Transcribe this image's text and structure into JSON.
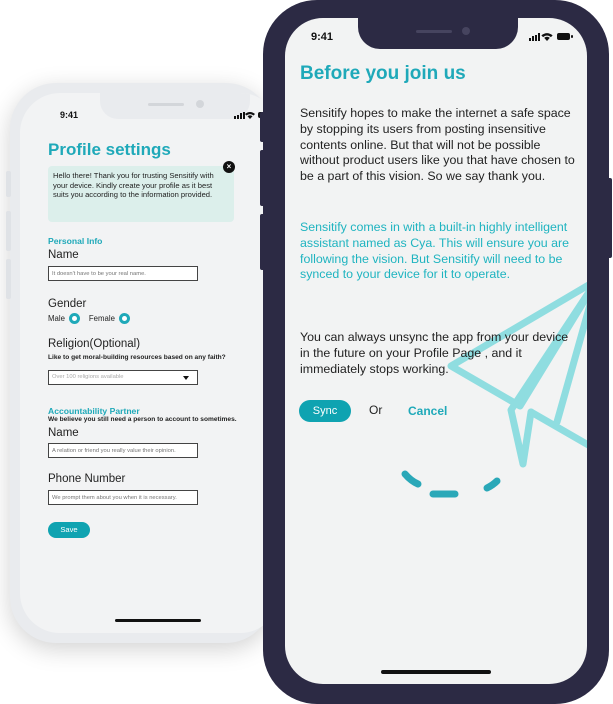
{
  "profile_phone": {
    "status_time": "9:41",
    "title": "Profile settings",
    "welcome_message": "Hello there! Thank you for trusting Sensitify with your device. Kindly create your profile as it best suits you according to the information provided.",
    "close_glyph": "×",
    "personal_info": {
      "section_title": "Personal Info",
      "name_label": "Name",
      "name_placeholder": "It doesn't have to be your real name."
    },
    "gender": {
      "label": "Gender",
      "male_label": "Male",
      "female_label": "Female"
    },
    "religion": {
      "label": "Religion(Optional)",
      "subtitle": "Like to get moral-building resources based on any faith?",
      "select_placeholder": "Over 100 religions available"
    },
    "accountability": {
      "section_title": "Accountability Partner",
      "subtitle": "We believe you still need a person to account to sometimes.",
      "name_label": "Name",
      "name_placeholder": "A relation or friend you really value their opinion.",
      "phone_label": "Phone Number",
      "phone_placeholder": "We prompt them about you when it is necessary."
    },
    "save_label": "Save"
  },
  "join_phone": {
    "status_time": "9:41",
    "title": "Before you join us",
    "paragraph_1": "Sensitify hopes to make the internet a safe space by stopping its users from posting insensitive contents online. But that will not be possible without product users like you that have chosen to be a part of this vision. So we say thank you.",
    "paragraph_2": "Sensitify  comes in with a built-in highly intelligent assistant named as Cya. This will ensure you are following the vision. But Sensitify will need to be synced to your device for it to operate.",
    "paragraph_3": "You can always unsync the app from your device in the future on your Profile Page    , and it immediately stops working.",
    "sync_label": "Sync",
    "or_label": "Or",
    "cancel_label": "Cancel"
  },
  "colors": {
    "accent": "#1fa9b9",
    "button": "#0fa3b1",
    "frame": "#2c2a44",
    "card": "#dcefeb",
    "plane": "#8fdde0"
  },
  "icons": [
    "signal-icon",
    "wifi-icon",
    "battery-icon",
    "close-icon",
    "chevron-down-icon",
    "paper-plane-illustration"
  ]
}
